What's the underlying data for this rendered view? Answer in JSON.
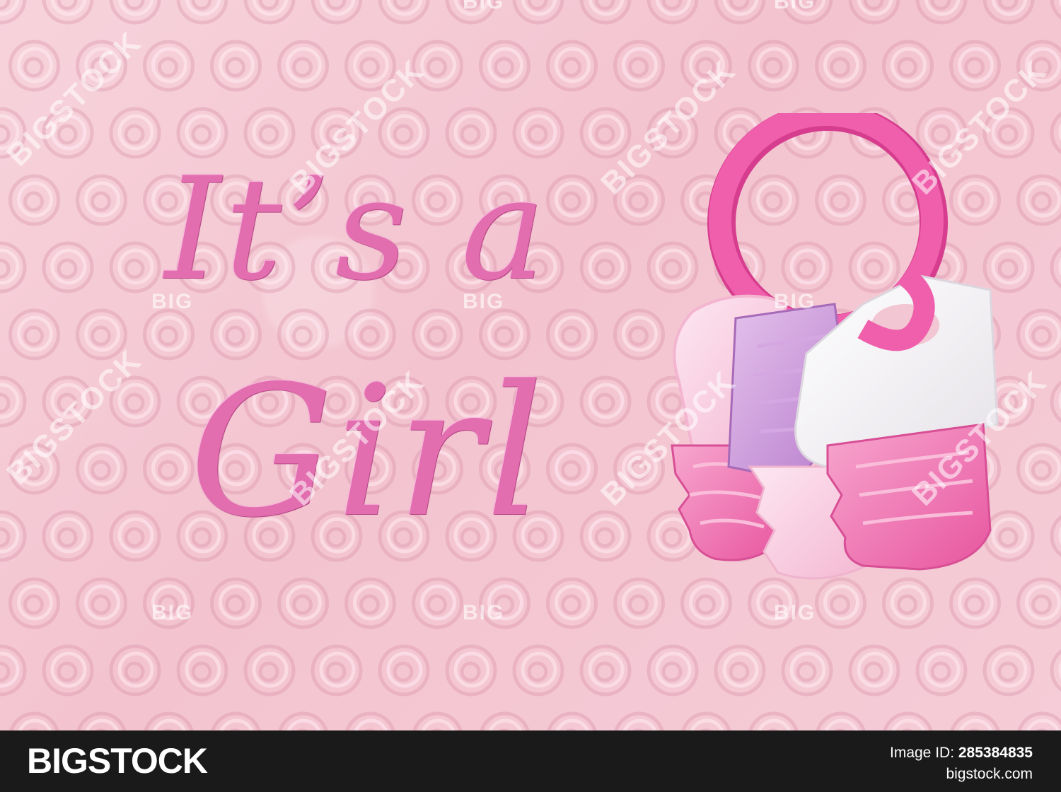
{
  "message": {
    "line1": "It’s a",
    "line2": "Girl"
  },
  "watermark": {
    "diagonal": "BIGSTOCK",
    "small": "BIG"
  },
  "footer": {
    "brand": "BIGSTOCK",
    "image_id_label": "Image ID: ",
    "image_id": "285384835",
    "url": "bigstock.com"
  },
  "colors": {
    "background": "#f3c6d1",
    "text": "#e26eb0",
    "rattle_ring": "#ec4fa5",
    "key_white": "#f6f4f6",
    "key_lilac": "#c592d6",
    "key_pink": "#ee82bd",
    "footer": "#1a1a1a"
  }
}
